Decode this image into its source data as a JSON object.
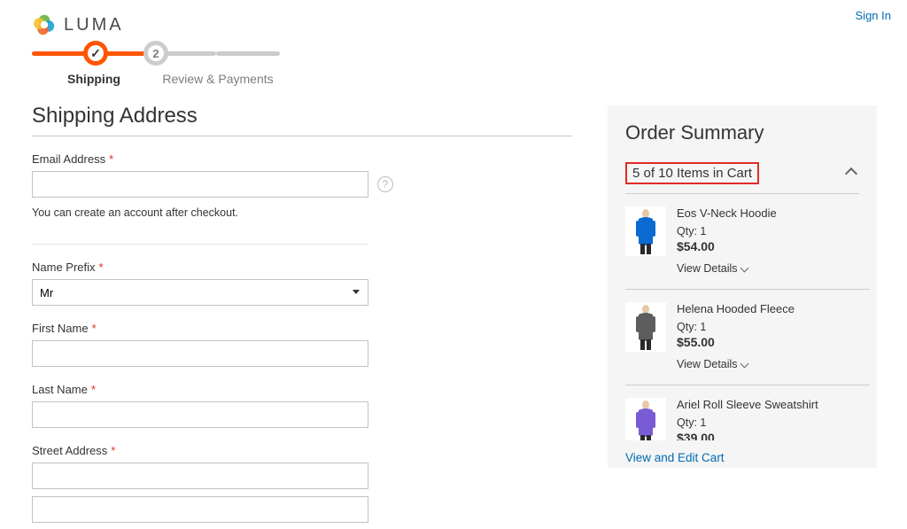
{
  "header": {
    "brand": "LUMA",
    "sign_in": "Sign In"
  },
  "progress": {
    "steps": [
      "Shipping",
      "Review & Payments"
    ]
  },
  "page": {
    "title": "Shipping Address"
  },
  "form": {
    "email": {
      "label": "Email Address",
      "hint": "You can create an account after checkout."
    },
    "prefix": {
      "label": "Name Prefix",
      "value": "Mr"
    },
    "first_name": {
      "label": "First Name"
    },
    "last_name": {
      "label": "Last Name"
    },
    "street": {
      "label": "Street Address"
    }
  },
  "summary": {
    "title": "Order Summary",
    "cart_header": "5 of 10 Items in Cart",
    "view_details": "View Details",
    "view_edit": "View and Edit Cart",
    "qty_label": "Qty",
    "items": [
      {
        "name": "Eos V-Neck Hoodie",
        "qty": 1,
        "price": "$54.00",
        "color": "#0a6ad1"
      },
      {
        "name": "Helena Hooded Fleece",
        "qty": 1,
        "price": "$55.00",
        "color": "#5d5d5d"
      },
      {
        "name": "Ariel Roll Sleeve Sweatshirt",
        "qty": 1,
        "price": "$39.00",
        "color": "#7a5bd6"
      }
    ]
  }
}
